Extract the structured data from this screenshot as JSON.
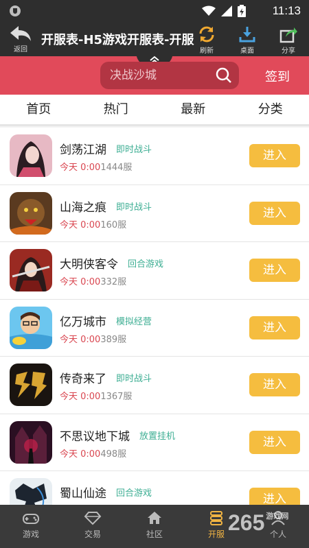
{
  "status_bar": {
    "time": "11:13"
  },
  "title_bar": {
    "back_label": "返回",
    "title": "开服表-H5游戏开服表-开服",
    "refresh_label": "刷新",
    "desktop_label": "桌面",
    "share_label": "分享"
  },
  "search": {
    "placeholder": "决战沙城",
    "signin_label": "签到"
  },
  "tabs": [
    "首页",
    "热门",
    "最新",
    "分类"
  ],
  "games": [
    {
      "name": "剑荡江湖",
      "tag": "即时战斗",
      "today": "今天 0:00",
      "server": "1444服",
      "button": "进入",
      "icon": "swordsman-avatar-icon"
    },
    {
      "name": "山海之痕",
      "tag": "即时战斗",
      "today": "今天 0:00",
      "server": "160服",
      "button": "进入",
      "icon": "beast-avatar-icon"
    },
    {
      "name": "大明侠客令",
      "tag": "回合游戏",
      "today": "今天 0:00",
      "server": "332服",
      "button": "进入",
      "icon": "warrior-avatar-icon"
    },
    {
      "name": "亿万城市",
      "tag": "模拟经营",
      "today": "今天 0:00",
      "server": "389服",
      "button": "进入",
      "icon": "cartoon-man-icon"
    },
    {
      "name": "传奇来了",
      "tag": "即时战斗",
      "today": "今天 0:00",
      "server": "1367服",
      "button": "进入",
      "icon": "legend-logo-icon"
    },
    {
      "name": "不思议地下城",
      "tag": "放置挂机",
      "today": "今天 0:00",
      "server": "498服",
      "button": "进入",
      "icon": "dungeon-icon"
    },
    {
      "name": "蜀山仙途",
      "tag": "回合游戏",
      "today": "",
      "server": "",
      "button": "进入",
      "icon": "shu-logo-icon"
    }
  ],
  "bottom_nav": [
    {
      "label": "游戏",
      "icon": "gamepad-icon",
      "active": false
    },
    {
      "label": "交易",
      "icon": "diamond-icon",
      "active": false
    },
    {
      "label": "社区",
      "icon": "home-icon",
      "active": false
    },
    {
      "label": "开服",
      "icon": "server-list-icon",
      "active": true
    },
    {
      "label": "个人",
      "icon": "person-icon",
      "active": false
    }
  ],
  "watermark": {
    "text": "265",
    "suffix": "游戏网"
  },
  "colors": {
    "header": "#2e2e2e",
    "accent_red": "#e14a5a",
    "button_yellow": "#f5bd3f",
    "tag_green": "#3dae93",
    "active_nav": "#f1b443"
  }
}
